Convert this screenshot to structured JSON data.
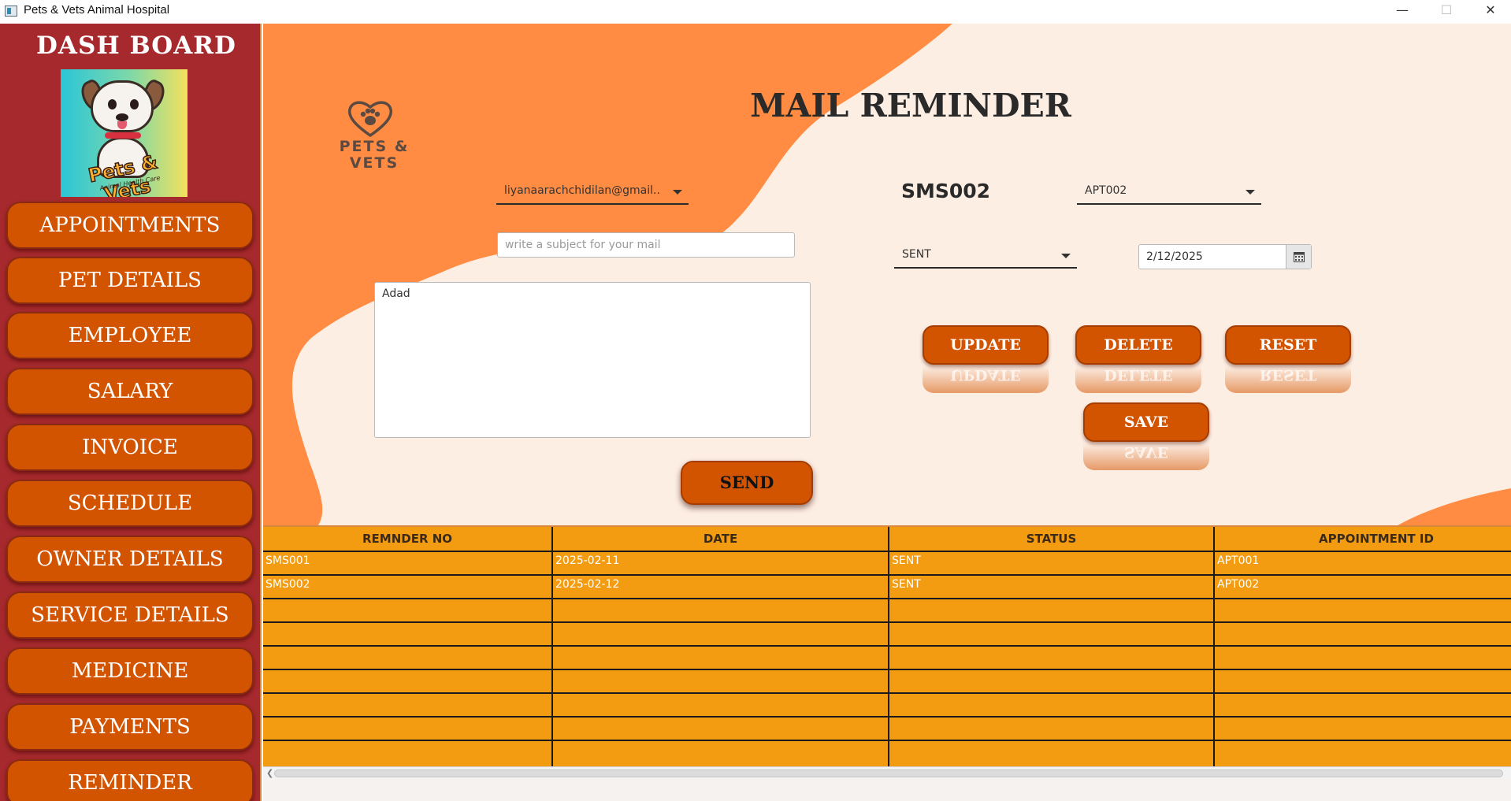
{
  "window": {
    "title": "Pets & Vets Animal Hospital",
    "controls": {
      "minimize": "—",
      "maximize": "☐",
      "close": "✕"
    }
  },
  "sidebar": {
    "title": "DASH BOARD",
    "logo_text": "Pets & Vets",
    "logo_subtext": "Animal Health Care",
    "items": [
      {
        "label": "APPOINTMENTS"
      },
      {
        "label": "PET DETAILS"
      },
      {
        "label": "EMPLOYEE"
      },
      {
        "label": "SALARY"
      },
      {
        "label": "INVOICE"
      },
      {
        "label": "SCHEDULE"
      },
      {
        "label": "OWNER DETAILS"
      },
      {
        "label": "SERVICE DETAILS"
      },
      {
        "label": "MEDICINE"
      },
      {
        "label": "PAYMENTS"
      },
      {
        "label": "REMINDER"
      }
    ]
  },
  "brand": {
    "line1": "PETS &",
    "line2": "VETS"
  },
  "page": {
    "title": "MAIL REMINDER"
  },
  "form": {
    "email_select": "liyanaarachchidilan@gmail....",
    "subject_placeholder": "write a subject for your mail",
    "subject_value": "",
    "body_value": "Adad",
    "reminder_id": "SMS002",
    "appointment_select": "APT002",
    "status_select": "SENT",
    "date_value": "2/12/2025"
  },
  "buttons": {
    "update": "UPDATE",
    "delete": "DELETE",
    "reset": "RESET",
    "save": "SAVE",
    "send": "SEND"
  },
  "table": {
    "columns": [
      "REMNDER NO",
      "DATE",
      "STATUS",
      "APPOINTMENT ID"
    ],
    "rows": [
      [
        "SMS001",
        "2025-02-11",
        "SENT",
        "APT001"
      ],
      [
        "SMS002",
        "2025-02-12",
        "SENT",
        "APT002"
      ]
    ]
  },
  "colors": {
    "sidebar_bg": "#a5292d",
    "button_orange": "#d35400",
    "blob_orange": "#ff8c42",
    "table_orange": "#f39c12",
    "main_bg": "#fdeee3"
  },
  "icons": {
    "calendar": "calendar-icon",
    "dropdown": "chevron-down-icon",
    "paw_heart": "paw-heart-icon"
  }
}
